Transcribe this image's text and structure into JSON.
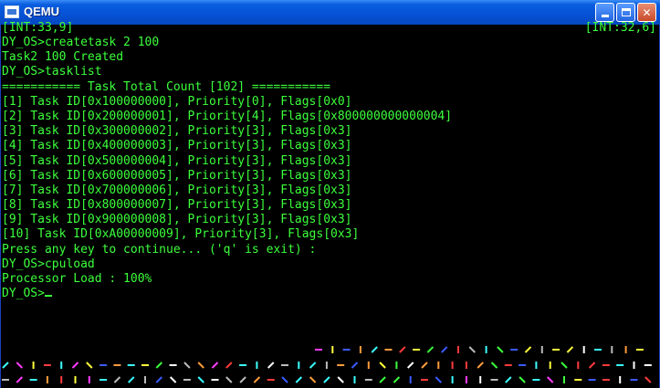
{
  "window": {
    "title": "QEMU",
    "buttons": [
      "minimize",
      "maximize",
      "close"
    ]
  },
  "status": {
    "left": "[INT:33,9]",
    "right": "[INT:32,6]"
  },
  "console": {
    "lines": [
      "DY_OS>createtask 2 100",
      "Task2 100 Created",
      "DY_OS>tasklist",
      "=========== Task Total Count [102] ===========",
      "[1] Task ID[0x100000000], Priority[0], Flags[0x0]",
      "[2] Task ID[0x200000001], Priority[4], Flags[0x800000000000004]",
      "[3] Task ID[0x300000002], Priority[3], Flags[0x3]",
      "[4] Task ID[0x400000003], Priority[3], Flags[0x3]",
      "[5] Task ID[0x500000004], Priority[3], Flags[0x3]",
      "[6] Task ID[0x600000005], Priority[3], Flags[0x3]",
      "[7] Task ID[0x700000006], Priority[3], Flags[0x3]",
      "[8] Task ID[0x800000007], Priority[3], Flags[0x3]",
      "[9] Task ID[0x900000008], Priority[3], Flags[0x3]",
      "[10] Task ID[0xA00000009], Priority[3], Flags[0x3]",
      "Press any key to continue... ('q' is exit) :",
      "DY_OS>cpuload",
      "Processor Load : 100%"
    ],
    "prompt": "DY_OS>"
  },
  "colors": {
    "text": "#3cff3c",
    "background": "#000000",
    "dash_palette": [
      "#ff3b3b",
      "#3bff3b",
      "#ffff3b",
      "#3bffff",
      "#3b5bff",
      "#ff3bff",
      "#ffffff",
      "#ff9b3b",
      "#bbbbbb"
    ]
  }
}
